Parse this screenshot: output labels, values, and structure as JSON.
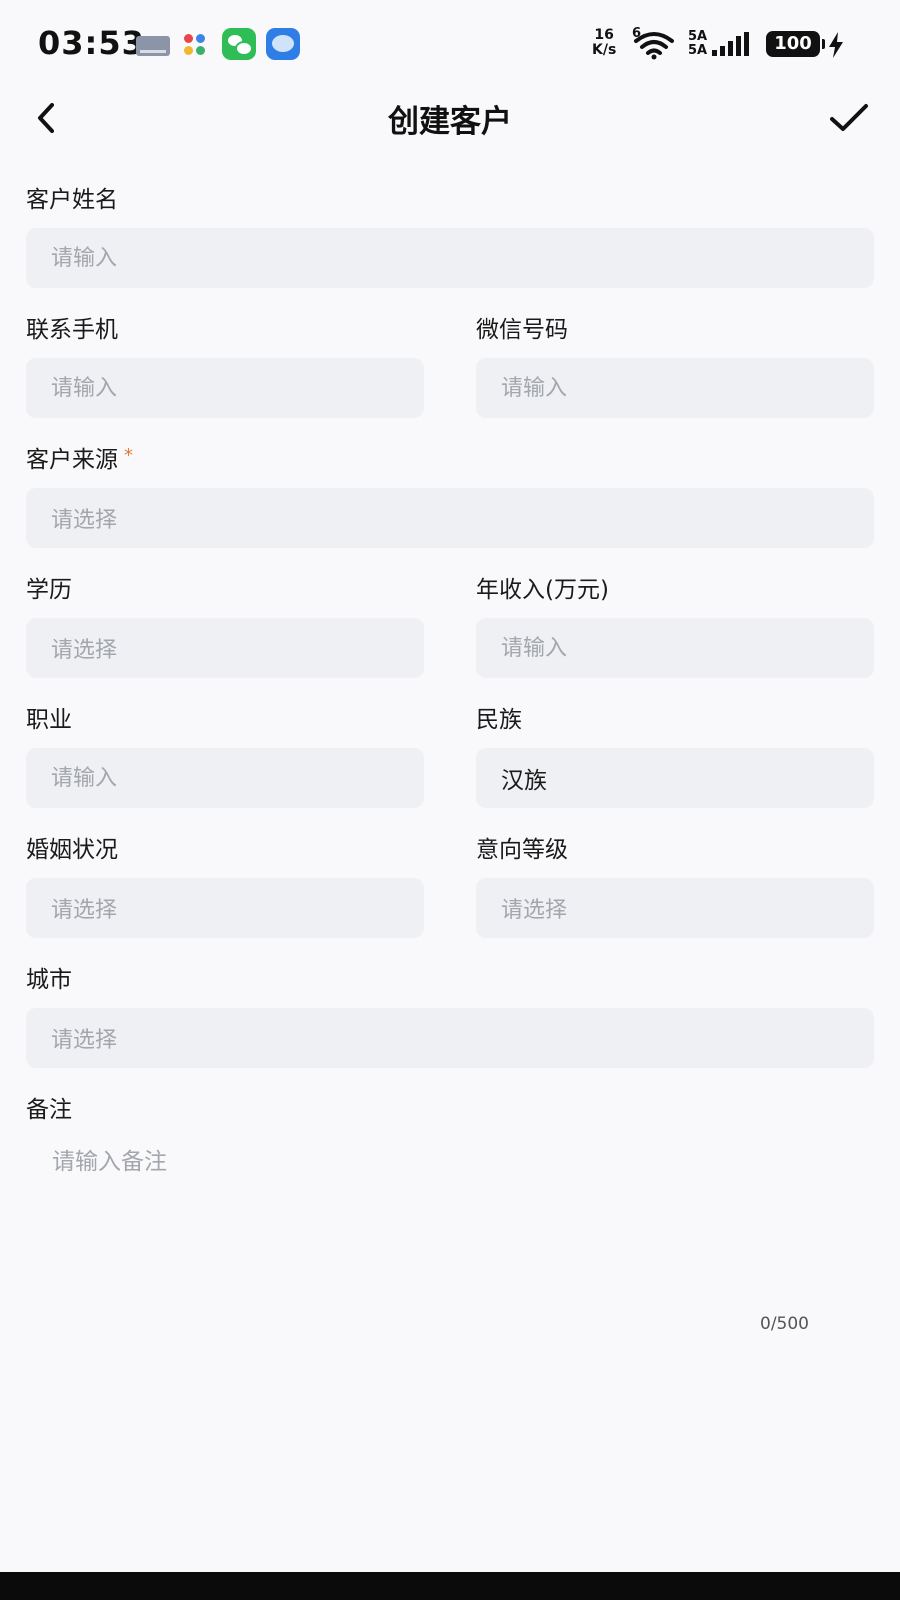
{
  "status_bar": {
    "time": "03:53",
    "network_speed_value": "16",
    "network_speed_unit": "K/s",
    "wifi_badge": "6",
    "signal_label_1": "5A",
    "signal_label_2": "5A",
    "battery": "100"
  },
  "header": {
    "title": "创建客户"
  },
  "form": {
    "customer_name": {
      "label": "客户姓名",
      "placeholder": "请输入"
    },
    "phone": {
      "label": "联系手机",
      "placeholder": "请输入"
    },
    "wechat": {
      "label": "微信号码",
      "placeholder": "请输入"
    },
    "source": {
      "label": "客户来源",
      "required_mark": "*",
      "placeholder": "请选择"
    },
    "education": {
      "label": "学历",
      "placeholder": "请选择"
    },
    "annual_income": {
      "label": "年收入(万元)",
      "placeholder": "请输入"
    },
    "occupation": {
      "label": "职业",
      "placeholder": "请输入"
    },
    "ethnicity": {
      "label": "民族",
      "value": "汉族"
    },
    "marital_status": {
      "label": "婚姻状况",
      "placeholder": "请选择"
    },
    "intent_level": {
      "label": "意向等级",
      "placeholder": "请选择"
    },
    "city": {
      "label": "城市",
      "placeholder": "请选择"
    },
    "remarks": {
      "label": "备注",
      "placeholder": "请输入备注",
      "char_count": "0/500"
    }
  },
  "colors": {
    "background": "#f9f9fb",
    "field_background": "#eff0f4",
    "placeholder": "#a3a6ad",
    "required": "#e07b39"
  }
}
